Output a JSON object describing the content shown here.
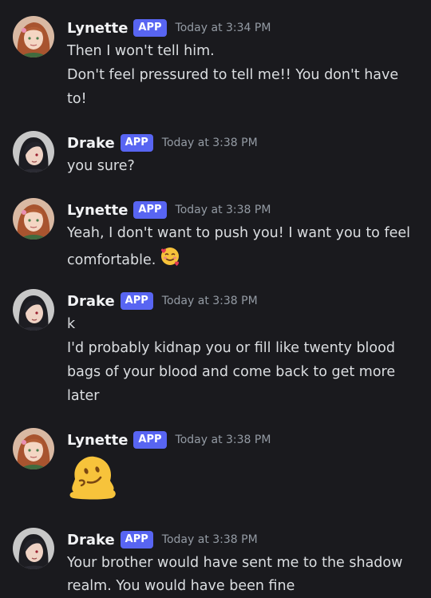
{
  "messages": [
    {
      "author": "Lynette",
      "badge": "APP",
      "time": "Today at 3:34 PM",
      "lines": [
        "Then I won't tell him.",
        "Don't feel pressured to tell me!! You don't have",
        "to!"
      ]
    },
    {
      "author": "Drake",
      "badge": "APP",
      "time": "Today at 3:38 PM",
      "lines": [
        "you sure?"
      ]
    },
    {
      "author": "Lynette",
      "badge": "APP",
      "time": "Today at 3:38 PM",
      "lines": [
        "Yeah, I don't want to push you! I want you to feel",
        "comfortable."
      ],
      "inline_emoji": "smiling-face-with-hearts"
    },
    {
      "author": "Drake",
      "badge": "APP",
      "time": "Today at 3:38 PM",
      "lines": [
        "k",
        "I'd probably kidnap you or fill like twenty blood",
        "bags of your blood and come back to get more",
        "later"
      ]
    },
    {
      "author": "Lynette",
      "badge": "APP",
      "time": "Today at 3:38 PM",
      "lines": [],
      "big_emoji": "melting-face"
    },
    {
      "author": "Drake",
      "badge": "APP",
      "time": "Today at 3:38 PM",
      "lines": [
        "Your brother would have sent me to the shadow",
        "realm. You would have been fine"
      ]
    }
  ],
  "colors": {
    "background": "#1a1a1e",
    "badge": "#5865f2",
    "text": "#dbdee1",
    "timestamp": "#949ba4"
  }
}
